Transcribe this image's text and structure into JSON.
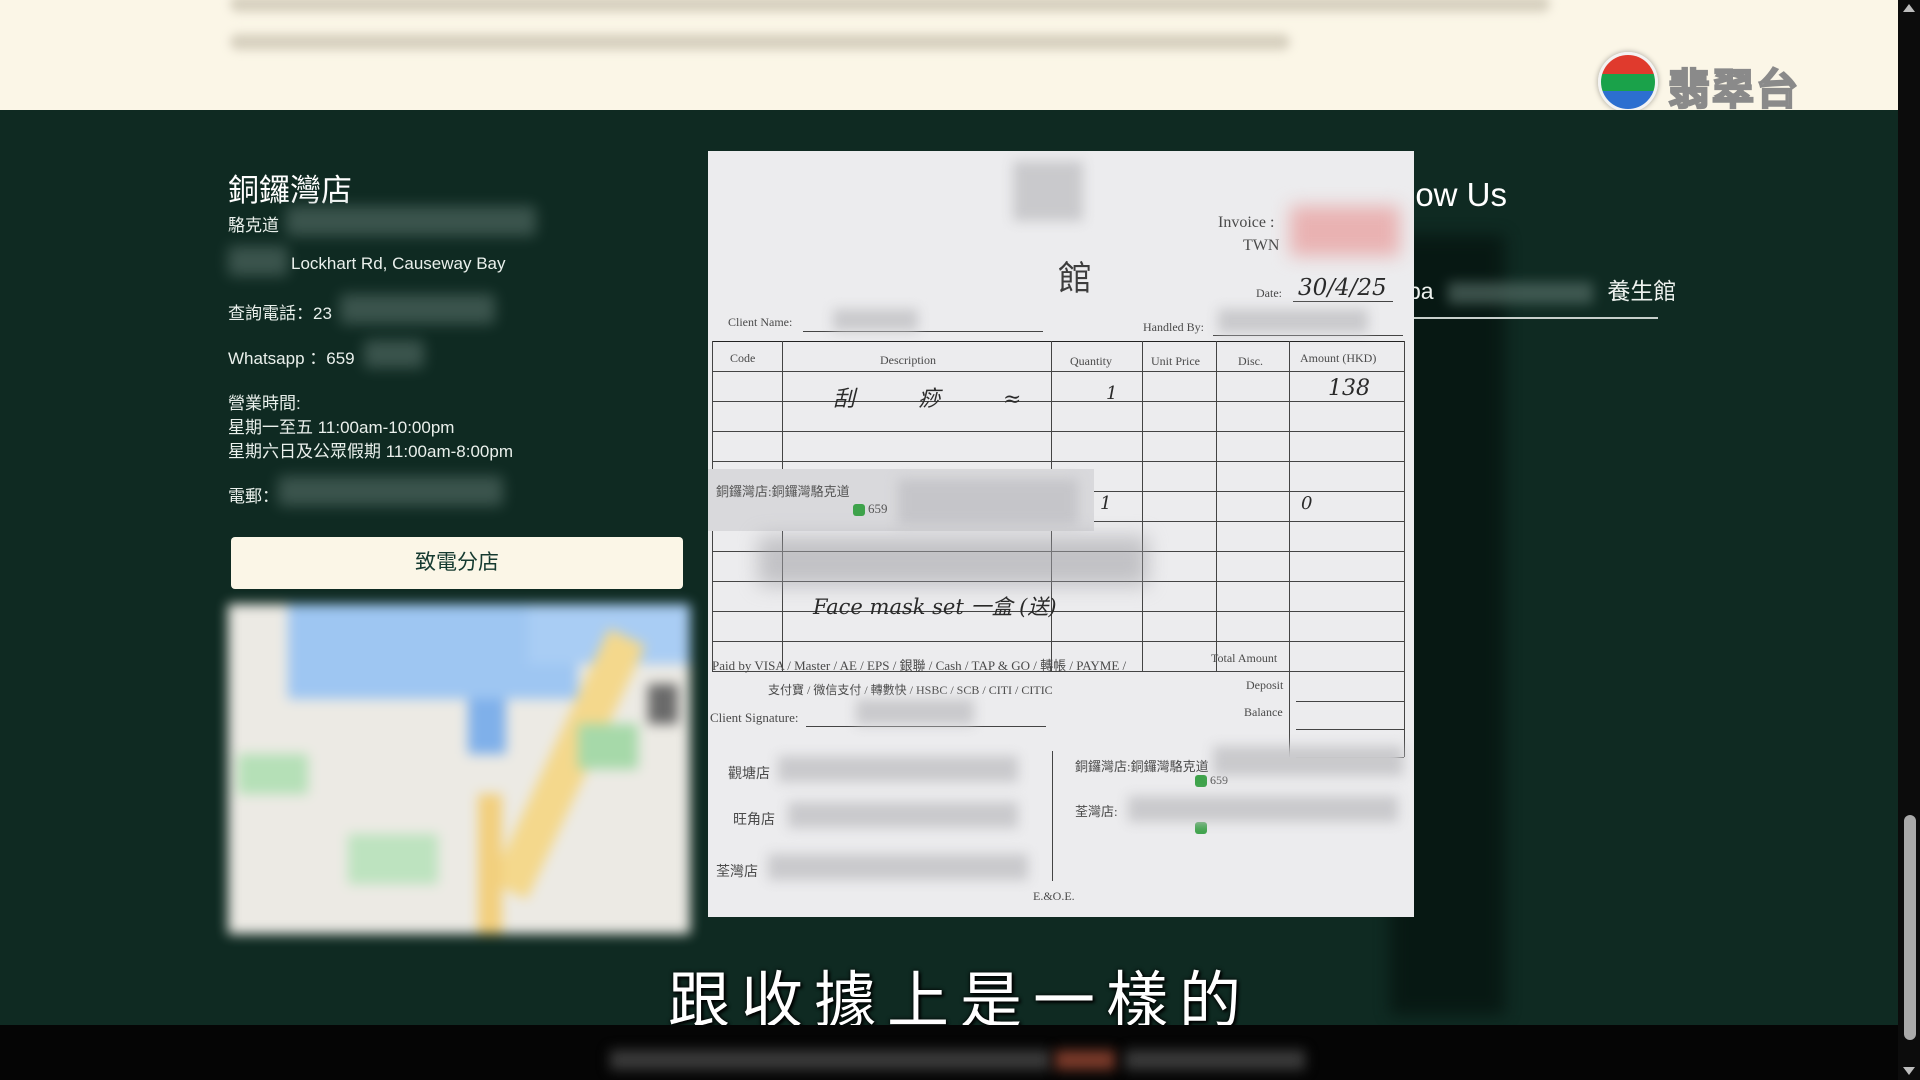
{
  "broadcaster": {
    "logo_text": "翡翠台"
  },
  "store": {
    "title": "銅鑼灣店",
    "address_line1": "駱克道",
    "address_line2": "Lockhart Rd, Causeway Bay",
    "phone_label": "查詢電話：23",
    "whatsapp_label": "Whatsapp ：659",
    "hours_label": "營業時間:",
    "hours_weekday": "星期一至五 11:00am-10:00pm",
    "hours_weekend": "星期六日及公眾假期 11:00am-8:00pm",
    "email_label": "電郵：",
    "call_button": "致電分店"
  },
  "follow": {
    "title_fragment": "low Us",
    "row_left": "pa",
    "row_right": "養生館"
  },
  "receipt": {
    "shop_char": "館",
    "invoice_label": "Invoice :",
    "invoice_prefix": "TWN",
    "date_label": "Date:",
    "date_value": "30/4/25",
    "client_name_label": "Client Name:",
    "handled_by_label": "Handled By:",
    "col_code": "Code",
    "col_description": "Description",
    "col_quantity": "Quantity",
    "col_unit_price": "Unit Price",
    "col_disc": "Disc.",
    "col_amount": "Amount (HKD)",
    "row1_qty": "1",
    "row1_amount": "138",
    "row_mid_qty": "1",
    "row_mid_amount": "0",
    "row_free": "Face mask set 一盒 (送)",
    "overlay_address": "銅鑼灣店:銅鑼灣駱克道",
    "overlay_whatsapp": "659",
    "paid_by_line1": "Paid by VISA / Master / AE / EPS / 銀聯 / Cash / TAP & GO / 轉帳 / PAYME /",
    "paid_by_line2": "支付寶 / 微信支付 / 轉數快 / HSBC    / SCB    / CITI    / CITIC",
    "total_amount_label": "Total Amount",
    "deposit_label": "Deposit",
    "balance_label": "Balance",
    "client_signature_label": "Client Signature:",
    "branch1": "觀塘店",
    "branch2": "旺角店",
    "branch3": "荃灣店",
    "branch_right1": "銅鑼灣店:銅鑼灣駱克道",
    "branch_right1_wa": "659",
    "branch_right2": "荃灣店:",
    "eoe": "E.&O.E."
  },
  "subtitle": "跟收據上是一樣的"
}
